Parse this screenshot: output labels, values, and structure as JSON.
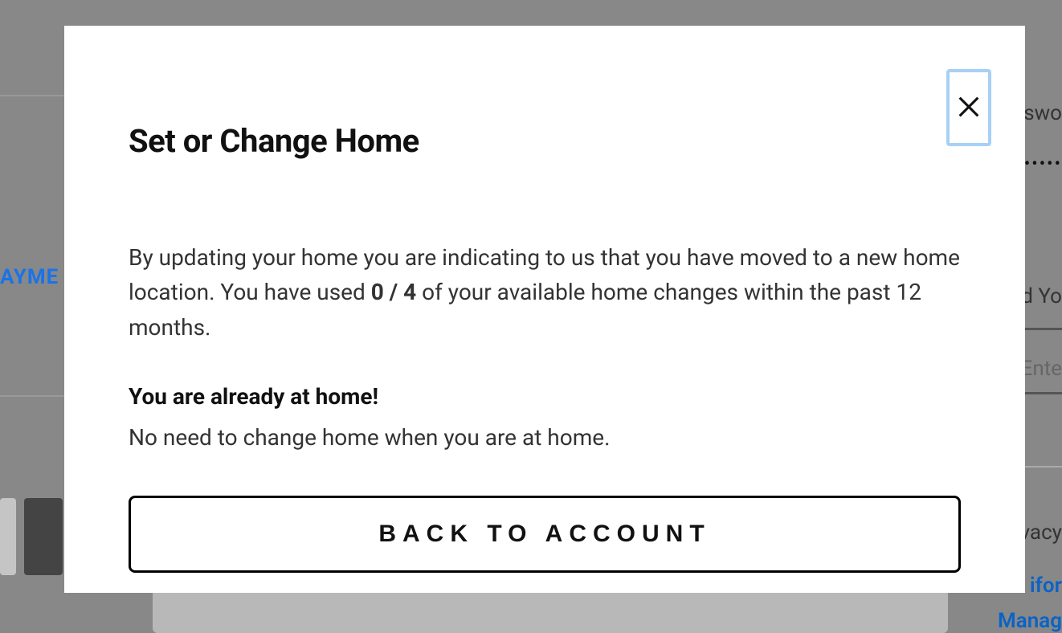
{
  "background": {
    "left_tab": "AYME",
    "right_swo": "swo",
    "right_dots": "•••••",
    "right_dyo": "d Yo",
    "right_ente": "Ente",
    "right_vacy": "vacy",
    "right_ifor": "ifor",
    "right_manag": "Manag"
  },
  "modal": {
    "title": "Set or Change Home",
    "body_pre": "By updating your home you are indicating to us that you have moved to a new home location. You have used ",
    "usage": "0 / 4",
    "body_post": " of your available home changes within the past 12 months.",
    "subtitle": "You are already at home!",
    "subtext": "No need to change home when you are at home.",
    "back_button_label": "BACK TO ACCOUNT"
  }
}
